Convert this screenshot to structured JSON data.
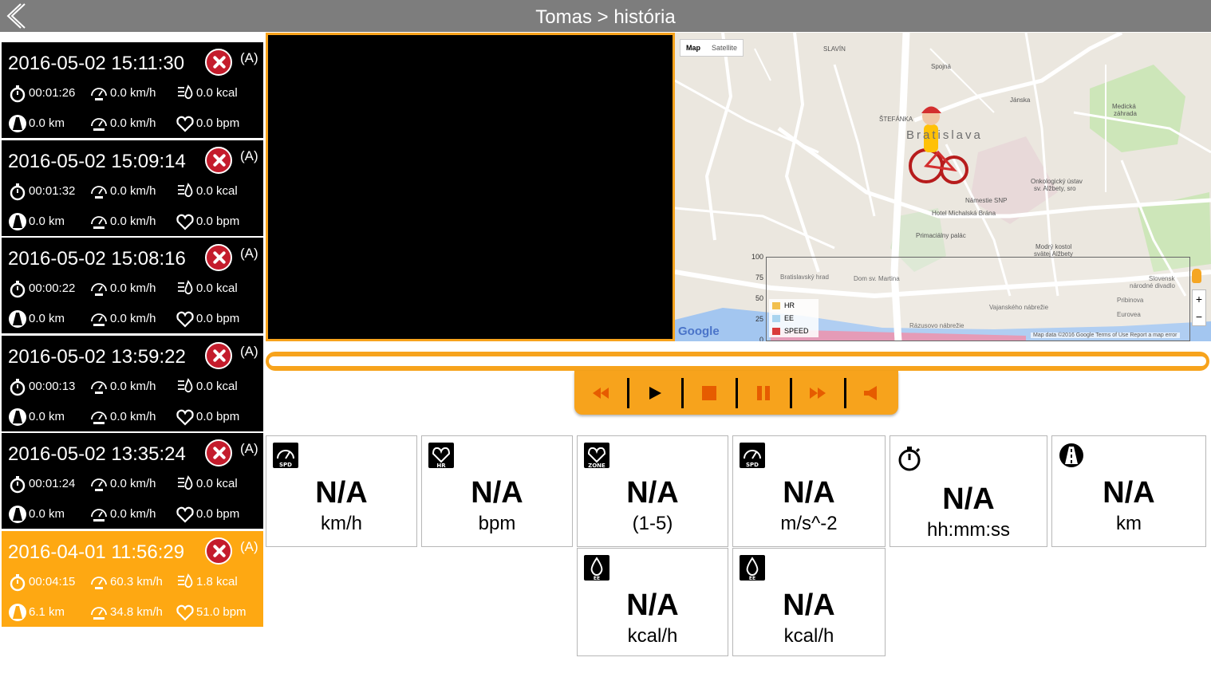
{
  "header": {
    "title": "Tomas > história",
    "back_icon": "back-chevron-icon"
  },
  "colors": {
    "header": "#7d7d7d",
    "accent": "#f7a31c",
    "active_session": "#fea812",
    "delete": "#c41c2c",
    "session_bg": "#000000"
  },
  "sessions": [
    {
      "date": "2016-05-02 15:11:30",
      "tag": "(A)",
      "duration": "00:01:26",
      "avg_speed": "0.0 km/h",
      "energy": "0.0 kcal",
      "distance": "0.0 km",
      "max_speed": "0.0 km/h",
      "heart_rate": "0.0 bpm",
      "active": false
    },
    {
      "date": "2016-05-02 15:09:14",
      "tag": "(A)",
      "duration": "00:01:32",
      "avg_speed": "0.0 km/h",
      "energy": "0.0 kcal",
      "distance": "0.0 km",
      "max_speed": "0.0 km/h",
      "heart_rate": "0.0 bpm",
      "active": false
    },
    {
      "date": "2016-05-02 15:08:16",
      "tag": "(A)",
      "duration": "00:00:22",
      "avg_speed": "0.0 km/h",
      "energy": "0.0 kcal",
      "distance": "0.0 km",
      "max_speed": "0.0 km/h",
      "heart_rate": "0.0 bpm",
      "active": false
    },
    {
      "date": "2016-05-02 13:59:22",
      "tag": "(A)",
      "duration": "00:00:13",
      "avg_speed": "0.0 km/h",
      "energy": "0.0 kcal",
      "distance": "0.0 km",
      "max_speed": "0.0 km/h",
      "heart_rate": "0.0 bpm",
      "active": false
    },
    {
      "date": "2016-05-02 13:35:24",
      "tag": "(A)",
      "duration": "00:01:24",
      "avg_speed": "0.0 km/h",
      "energy": "0.0 kcal",
      "distance": "0.0 km",
      "max_speed": "0.0 km/h",
      "heart_rate": "0.0 bpm",
      "active": false
    },
    {
      "date": "2016-04-01 11:56:29",
      "tag": "(A)",
      "duration": "00:04:15",
      "avg_speed": "60.3 km/h",
      "energy": "1.8 kcal",
      "distance": "6.1 km",
      "max_speed": "34.8 km/h",
      "heart_rate": "51.0 bpm",
      "active": true
    }
  ],
  "map": {
    "type_buttons": [
      "Map",
      "Satellite"
    ],
    "selected_type": "Map",
    "graph_ticks": [
      "100",
      "75",
      "50",
      "25",
      "0"
    ],
    "legend": [
      {
        "label": "HR",
        "color": "#f2c04e"
      },
      {
        "label": "EE",
        "color": "#a9d4ef"
      },
      {
        "label": "SPEED",
        "color": "#d93a3a"
      }
    ],
    "labels": {
      "city": "Bratislava",
      "slavin": "SLAVÍN",
      "stefanka": "ŠTEFÁNKA",
      "onko": "Onkologický ústav",
      "onko2": "sv. Alžbety, sro",
      "michal": "Hotel Michalská Brána",
      "primac": "Primaciálny palác",
      "hrad": "Bratislavský hrad",
      "dom": "Dom sv. Martina",
      "modry": "Modrý kostol",
      "modry2": "svätej Alžbety",
      "snp": "Námestie SNP",
      "medic": "Medická",
      "medic2": "záhrada",
      "pribinova": "Pribinova",
      "eurovea": "Eurovea",
      "slovensk": "Slovensk",
      "narodne": "národné divadlo",
      "razus": "Rázusovo nábrežie",
      "vajansk": "Vajanského nábrežie",
      "spojna": "Spojná",
      "jan": "Jánska"
    },
    "google_logo": "Google",
    "attribution": "Map data ©2016 Google   Terms of Use   Report a map error",
    "zoom_in": "+",
    "zoom_out": "−"
  },
  "controls": [
    "rewind-icon",
    "play-icon",
    "stop-icon",
    "pause-icon",
    "fast-forward-icon",
    "volume-icon"
  ],
  "metrics": [
    {
      "icon": "speedometer-spd-icon",
      "value": "N/A",
      "unit": "km/h"
    },
    {
      "icon": "heart-hr-icon",
      "value": "N/A",
      "unit": "bpm"
    },
    {
      "icon": "heart-zone-icon",
      "value": "N/A",
      "unit": "(1-5)"
    },
    {
      "icon": "speedometer-spd-icon",
      "value": "N/A",
      "unit": "m/s^-2"
    },
    {
      "icon": "stopwatch-icon",
      "value": "N/A",
      "unit": "hh:mm:ss"
    },
    {
      "icon": "road-icon",
      "value": "N/A",
      "unit": "km"
    },
    {
      "icon": "drop-ee-icon",
      "value": "N/A",
      "unit": "kcal/h"
    },
    {
      "icon": "drop-ee-icon",
      "value": "N/A",
      "unit": "kcal/h"
    }
  ]
}
